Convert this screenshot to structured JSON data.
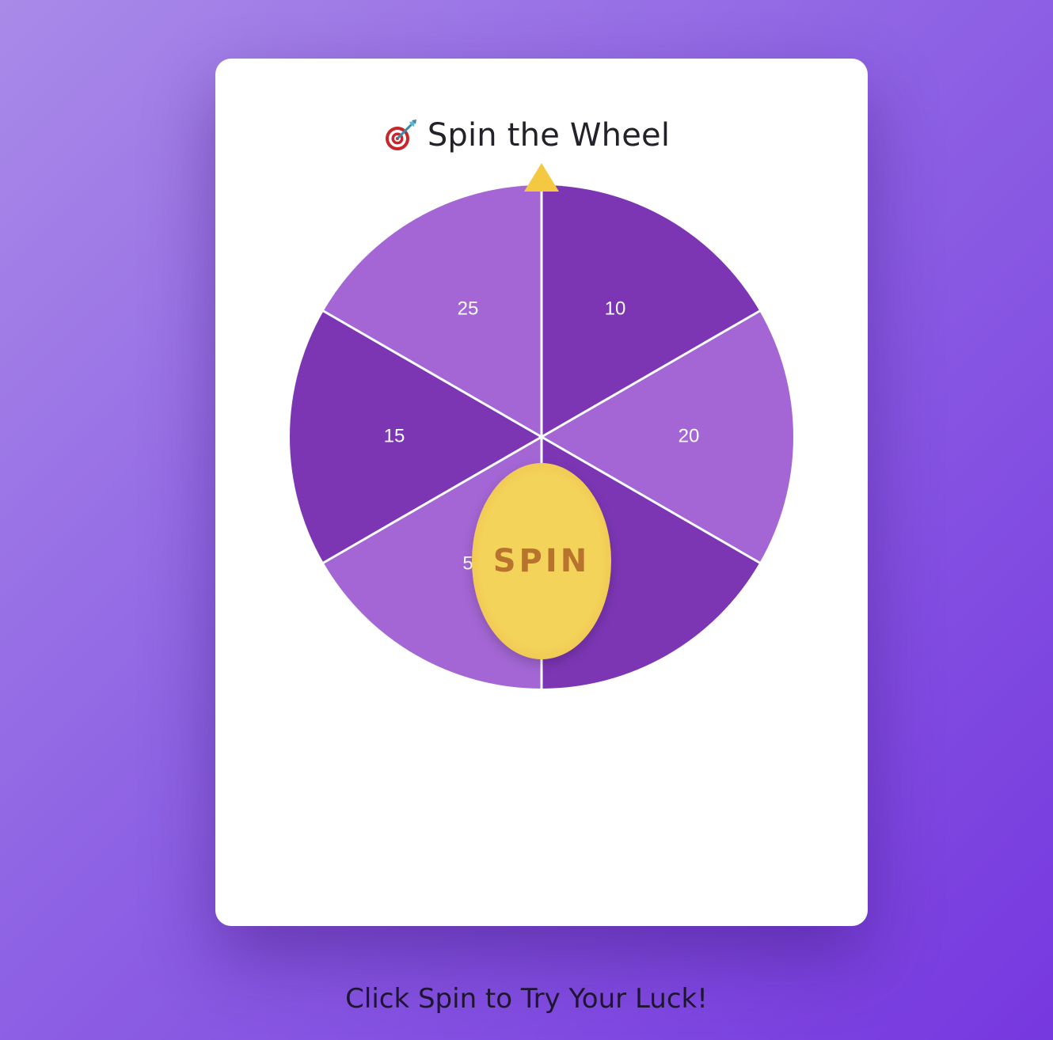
{
  "header": {
    "icon": "dart-target-icon",
    "title": "Spin the Wheel"
  },
  "wheel": {
    "segments": [
      {
        "label": "10",
        "color": "#7c36b4"
      },
      {
        "label": "20",
        "color": "#a366d4"
      },
      {
        "label": "",
        "color": "#7c36b4"
      },
      {
        "label": "5",
        "color": "#a366d4"
      },
      {
        "label": "15",
        "color": "#7c36b4"
      },
      {
        "label": "25",
        "color": "#a366d4"
      }
    ],
    "pointer_color": "#f5c842",
    "divider_color": "#ffffff"
  },
  "spin_button": {
    "label": "SPIN"
  },
  "status": {
    "message": "Click Spin to Try Your Luck!"
  },
  "colors": {
    "background_start": "#a98ae8",
    "background_end": "#7638df",
    "card": "#ffffff",
    "button_gold": "#f4d35a",
    "button_text": "#b8742e"
  }
}
